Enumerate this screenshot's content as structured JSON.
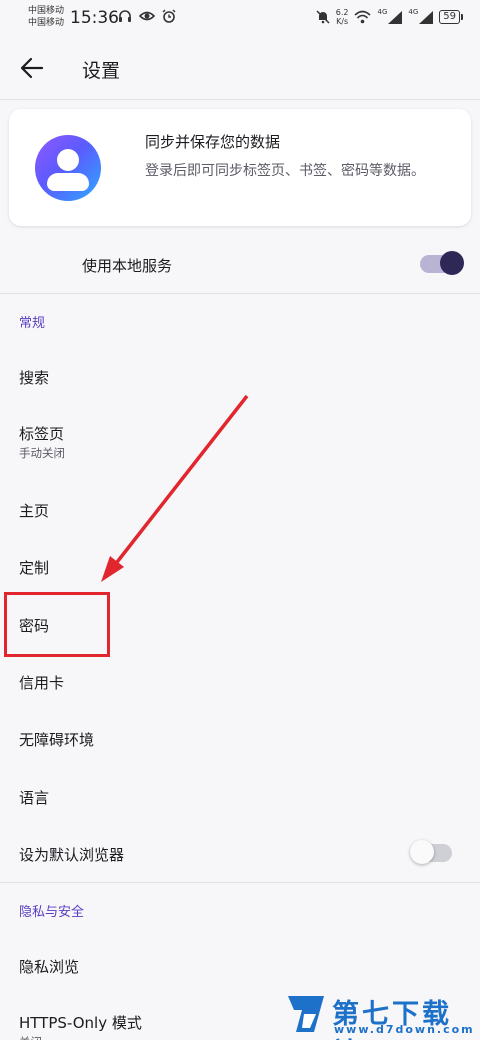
{
  "status_bar": {
    "carrier1": "中国移动",
    "carrier2": "中国移动",
    "time": "15:36",
    "speed_value": "6.2",
    "speed_unit": "K/s",
    "signal1": "4G",
    "signal2": "4G",
    "battery": "59",
    "icons": [
      "headphones-icon",
      "eye-icon",
      "alarm-icon",
      "mute-icon",
      "wifi-icon",
      "signal-icon",
      "signal-icon",
      "battery-icon"
    ]
  },
  "header": {
    "title": "设置",
    "back_icon": "back-arrow-icon"
  },
  "account_card": {
    "title": "同步并保存您的数据",
    "description": "登录后即可同步标签页、书签、密码等数据。"
  },
  "local_service": {
    "label": "使用本地服务",
    "enabled": true
  },
  "sections": [
    {
      "header": "常规",
      "items": [
        {
          "label": "搜索"
        },
        {
          "label": "标签页",
          "subtitle": "手动关闭"
        },
        {
          "label": "主页"
        },
        {
          "label": "定制"
        },
        {
          "label": "密码"
        },
        {
          "label": "信用卡"
        },
        {
          "label": "无障碍环境"
        },
        {
          "label": "语言"
        },
        {
          "label": "设为默认浏览器",
          "toggle": false
        }
      ]
    },
    {
      "header": "隐私与安全",
      "items": [
        {
          "label": "隐私浏览"
        },
        {
          "label": "HTTPS-Only 模式",
          "subtitle": "关闭"
        }
      ]
    }
  ],
  "annotation": {
    "color": "#e1262e",
    "highlighted_item": "密码"
  },
  "watermark": {
    "text": "第七下载站",
    "url": "www.d7down.com"
  },
  "colors": {
    "accent": "#5a3dc2",
    "switch_on_knob": "#2d2856",
    "watermark": "#1d71c9"
  }
}
